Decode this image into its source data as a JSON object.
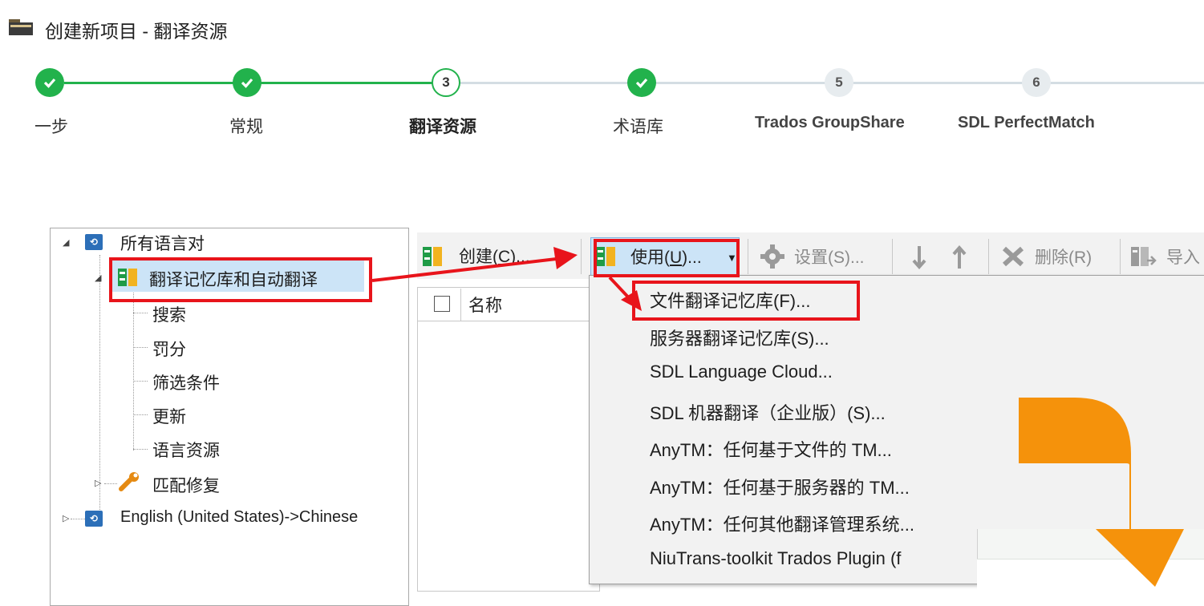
{
  "window": {
    "title": "创建新项目 - 翻译资源"
  },
  "steps": [
    {
      "label": "一步",
      "state": "done",
      "number": ""
    },
    {
      "label": "常规",
      "state": "done",
      "number": ""
    },
    {
      "label": "翻译资源",
      "state": "current",
      "number": "3"
    },
    {
      "label": "术语库",
      "state": "done",
      "number": ""
    },
    {
      "label": "Trados GroupShare",
      "state": "todo",
      "number": "5"
    },
    {
      "label": "SDL PerfectMatch",
      "state": "todo",
      "number": "6"
    }
  ],
  "tree": {
    "root": "所有语言对",
    "tm_node": "翻译记忆库和自动翻译",
    "children": [
      "搜索",
      "罚分",
      "筛选条件",
      "更新",
      "语言资源"
    ],
    "match_repair": "匹配修复",
    "lang_pair": "English (United States)->Chinese"
  },
  "toolbar": {
    "create": "创建(C)...",
    "create_key": "C",
    "use": "使用(U)...",
    "use_key": "U",
    "settings": "设置(S)...",
    "delete": "删除(R)",
    "import": "导入"
  },
  "list": {
    "name_header": "名称"
  },
  "menu": {
    "items": [
      "文件翻译记忆库(F)...",
      "服务器翻译记忆库(S)...",
      "SDL Language Cloud...",
      "SDL 机器翻译（企业版）(S)...",
      "AnyTM：任何基于文件的 TM...",
      "AnyTM：任何基于服务器的 TM...",
      "AnyTM：任何其他翻译管理系统...",
      "NiuTrans-toolkit Trados Plugin (f"
    ]
  },
  "colors": {
    "highlight_red": "#e8141b",
    "step_green": "#22b24c",
    "selection_blue": "#cce4f7",
    "big_arrow_orange": "#f5920b"
  }
}
